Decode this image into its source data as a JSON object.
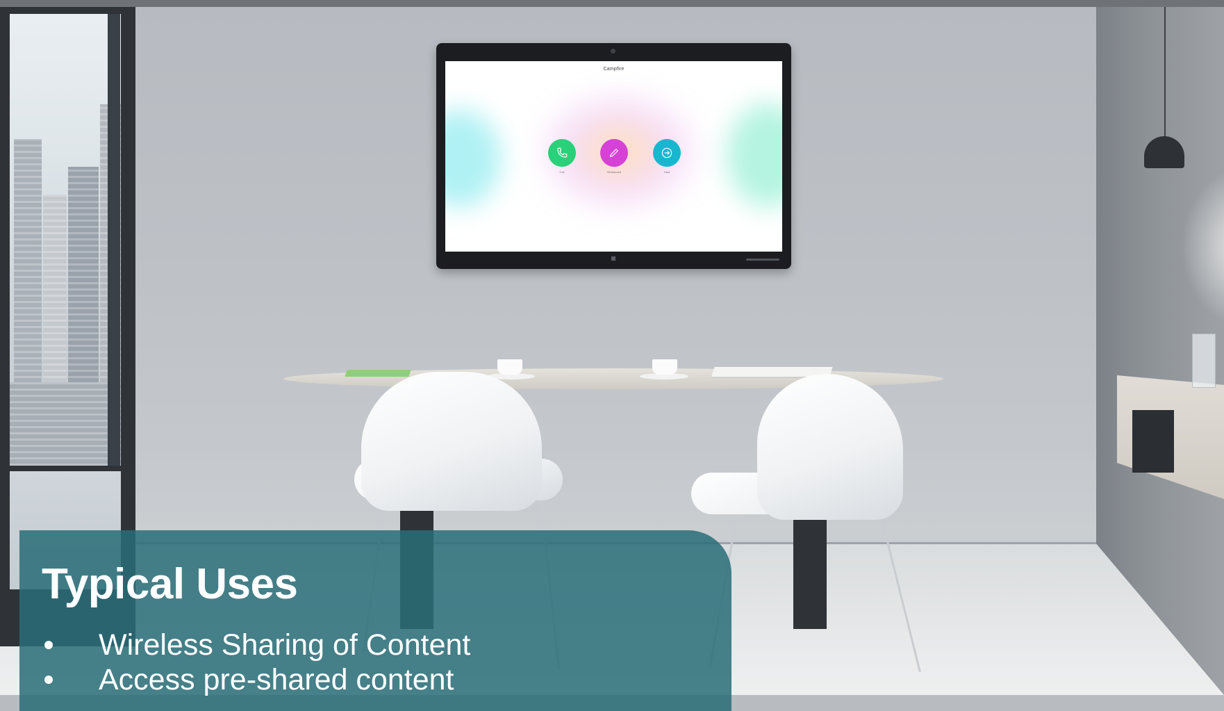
{
  "screen": {
    "title": "Campfire",
    "buttons": [
      {
        "label": "Call",
        "color": "#2bd07a",
        "icon": "phone-icon"
      },
      {
        "label": "Whiteboard",
        "color": "#d642d6",
        "icon": "pencil-icon"
      },
      {
        "label": "Host",
        "color": "#19b7cf",
        "icon": "arrow-right-circle-icon"
      }
    ]
  },
  "panel": {
    "title": "Typical Uses",
    "bg_color": "#2a6d78",
    "items": [
      "Wireless Sharing of Content",
      "Access pre-shared content"
    ]
  }
}
